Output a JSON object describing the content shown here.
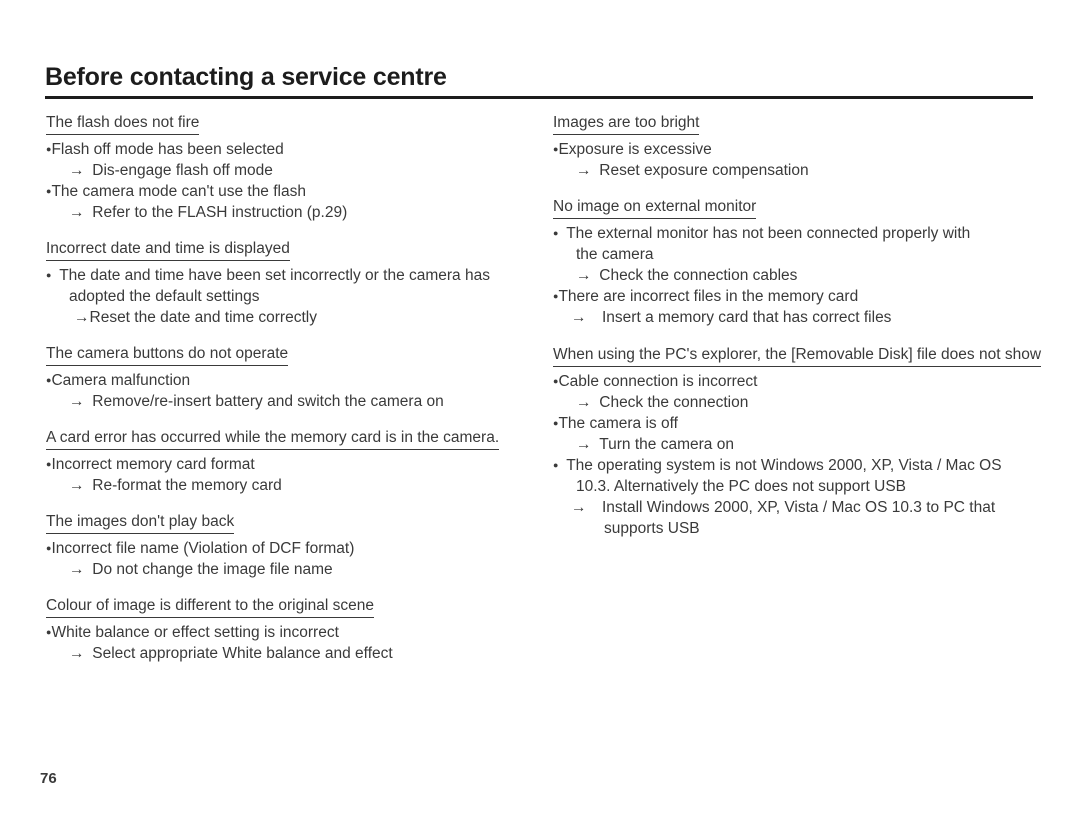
{
  "document": {
    "title": "Before contacting a service centre",
    "page_number": "76"
  },
  "glyphs": {
    "bullet": "●",
    "arrow": "→"
  },
  "left_column": {
    "sections": [
      {
        "heading": "The flash does not fire",
        "lines": [
          {
            "type": "bullet",
            "text": "Flash off mode has been selected"
          },
          {
            "type": "arrow",
            "text": "Dis-engage flash off mode"
          },
          {
            "type": "bullet",
            "text": "The camera mode can't use the flash"
          },
          {
            "type": "arrow",
            "text": "Refer to the FLASH instruction (p.29)"
          }
        ]
      },
      {
        "heading": "Incorrect date and time is displayed",
        "lines": [
          {
            "type": "bullet_wide",
            "text": "The date and time have been set incorrectly or the camera has"
          },
          {
            "type": "cont",
            "text": "adopted the default settings"
          },
          {
            "type": "arrow_tight",
            "text": "Reset the date and time correctly"
          }
        ]
      },
      {
        "heading": "The camera buttons do not operate",
        "lines": [
          {
            "type": "bullet",
            "text": "Camera malfunction"
          },
          {
            "type": "arrow",
            "text": "Remove/re-insert battery and switch the camera on"
          }
        ]
      },
      {
        "heading": "A card error has occurred while the memory card is in the camera.",
        "lines": [
          {
            "type": "bullet",
            "text": "Incorrect memory card format"
          },
          {
            "type": "arrow",
            "text": "Re-format the memory card"
          }
        ]
      },
      {
        "heading": "The images don't play back",
        "lines": [
          {
            "type": "bullet",
            "text": "Incorrect file name (Violation of DCF format)"
          },
          {
            "type": "arrow",
            "text": "Do not change the image file name"
          }
        ]
      },
      {
        "heading": "Colour of image is different to the original scene",
        "lines": [
          {
            "type": "bullet",
            "text": "White balance or effect setting is incorrect"
          },
          {
            "type": "arrow",
            "text": "Select appropriate White balance and effect"
          }
        ]
      }
    ]
  },
  "right_column": {
    "sections": [
      {
        "heading": "Images are too bright",
        "lines": [
          {
            "type": "bullet",
            "text": "Exposure is excessive"
          },
          {
            "type": "arrow",
            "text": "Reset exposure compensation"
          }
        ]
      },
      {
        "heading": "No image on external monitor",
        "lines": [
          {
            "type": "bullet_wide",
            "text": "The external monitor has not been connected properly with"
          },
          {
            "type": "cont",
            "text": "the camera"
          },
          {
            "type": "arrow",
            "text": "Check the connection cables"
          },
          {
            "type": "bullet",
            "text": "There are incorrect files in the memory card"
          },
          {
            "type": "arrow_loose",
            "text": "Insert a memory card that has correct files"
          }
        ]
      }
    ]
  },
  "full_width_section": {
    "heading": "When using the PC's explorer, the [Removable Disk] file does not show",
    "lines": [
      {
        "type": "bullet",
        "text": "Cable connection is incorrect"
      },
      {
        "type": "arrow",
        "text": "Check the connection"
      },
      {
        "type": "bullet",
        "text": "The camera is off"
      },
      {
        "type": "arrow",
        "text": "Turn the camera on"
      },
      {
        "type": "bullet_wide",
        "text": "The operating system is not Windows 2000, XP, Vista / Mac OS"
      },
      {
        "type": "cont",
        "text": "10.3. Alternatively the PC does not support USB"
      },
      {
        "type": "arrow_loose",
        "text": "Install Windows 2000, XP, Vista / Mac OS 10.3 to PC that"
      },
      {
        "type": "cont_deep",
        "text": "supports USB"
      }
    ]
  }
}
